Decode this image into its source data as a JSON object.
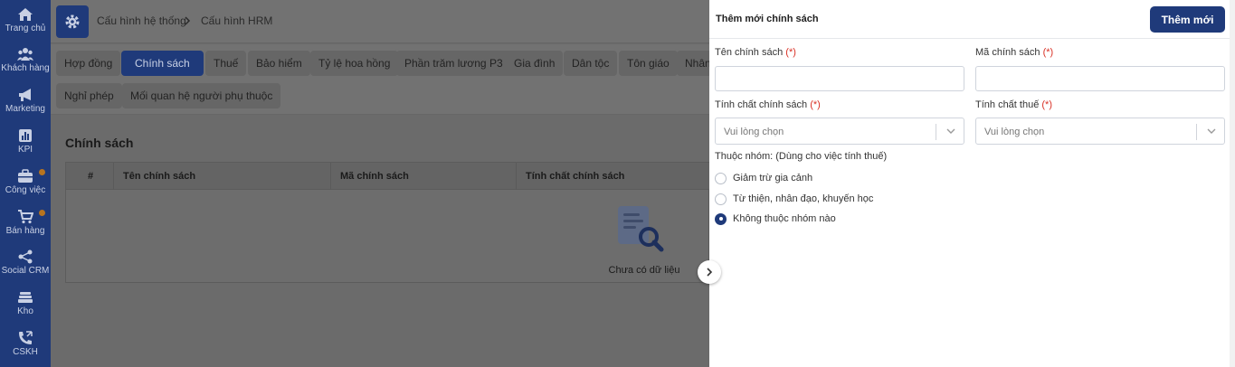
{
  "sidebar": {
    "items": [
      {
        "label": "Trang chủ",
        "icon": "home-icon"
      },
      {
        "label": "Khách hàng",
        "icon": "users-icon"
      },
      {
        "label": "Marketing",
        "icon": "megaphone-icon"
      },
      {
        "label": "KPI",
        "icon": "chart-icon"
      },
      {
        "label": "Công việc",
        "icon": "briefcase-icon"
      },
      {
        "label": "Bán hàng",
        "icon": "cart-icon"
      },
      {
        "label": "Social CRM",
        "icon": "share-icon"
      },
      {
        "label": "Kho",
        "icon": "warehouse-icon"
      },
      {
        "label": "CSKH",
        "icon": "phone-icon"
      }
    ]
  },
  "breadcrumb": {
    "parent": "Cấu hình hệ thống",
    "current": "Cấu hình HRM"
  },
  "tabs": [
    "Hợp đồng",
    "Chính sách",
    "Thuế",
    "Bảo hiểm",
    "Tỷ lệ hoa hồng",
    "Phần trăm lương P3",
    "Gia đình",
    "Dân tộc",
    "Tôn giáo",
    "Nhân",
    "Nghỉ phép",
    "Mối quan hệ người phụ thuộc"
  ],
  "active_tab": "Chính sách",
  "main": {
    "section_title": "Chính sách",
    "columns": [
      "#",
      "Tên chính sách",
      "Mã chính sách",
      "Tính chất chính sách"
    ],
    "empty_text": "Chưa có dữ liệu"
  },
  "panel": {
    "title": "Thêm mới chính sách",
    "submit_label": "Thêm mới",
    "required_mark": "(*)",
    "fields": {
      "policy_name": {
        "label": "Tên chính sách",
        "value": ""
      },
      "policy_code": {
        "label": "Mã chính sách",
        "value": ""
      },
      "policy_type": {
        "label": "Tính chất chính sách",
        "placeholder": "Vui lòng chọn"
      },
      "tax_type": {
        "label": "Tính chất thuế",
        "placeholder": "Vui lòng chọn"
      }
    },
    "group_label": "Thuộc nhóm: (Dùng cho việc tính thuế)",
    "group_options": [
      {
        "label": "Giảm trừ gia cảnh",
        "selected": false
      },
      {
        "label": "Từ thiện, nhân đạo, khuyến học",
        "selected": false
      },
      {
        "label": "Không thuộc nhóm nào",
        "selected": true
      }
    ]
  },
  "colors": {
    "brand": "#1f3a7a",
    "required": "#d93025"
  }
}
